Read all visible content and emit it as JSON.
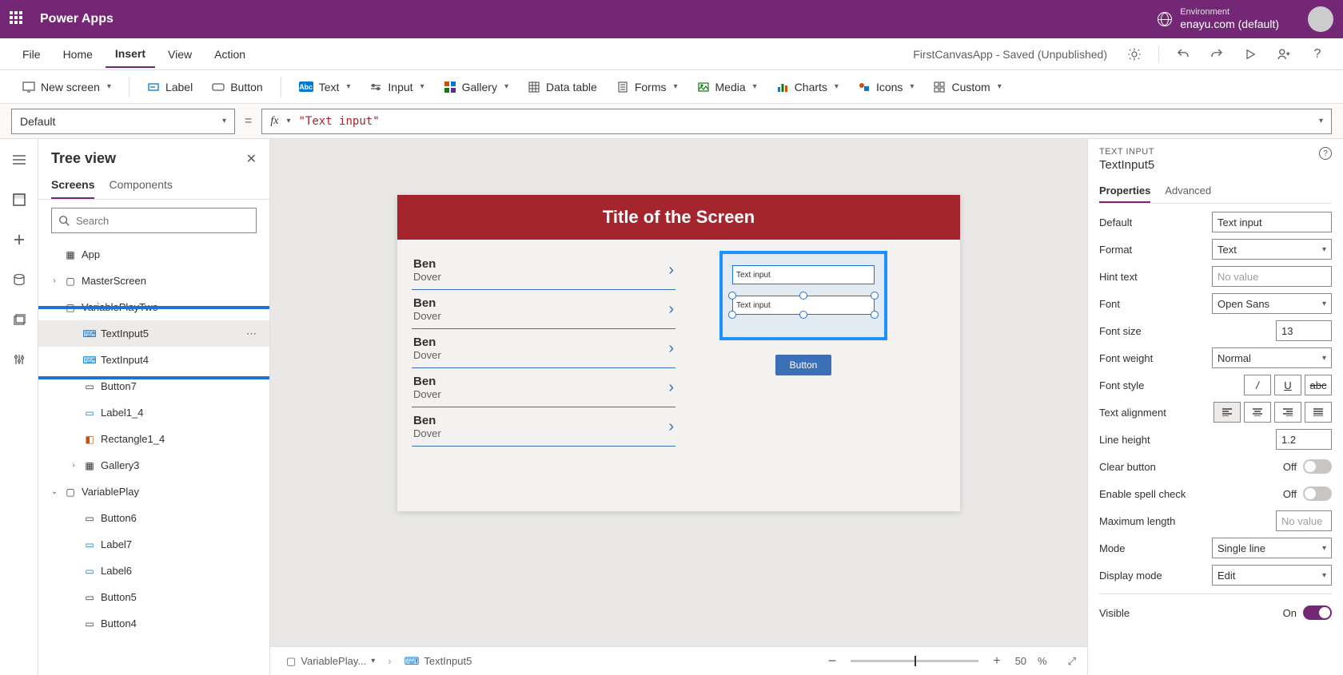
{
  "topbar": {
    "title": "Power Apps",
    "env_label": "Environment",
    "env_name": "enayu.com (default)"
  },
  "menu": {
    "items": [
      "File",
      "Home",
      "Insert",
      "View",
      "Action"
    ],
    "active": "Insert",
    "status": "FirstCanvasApp - Saved (Unpublished)"
  },
  "ribbon": {
    "newscreen": "New screen",
    "label": "Label",
    "button": "Button",
    "text": "Text",
    "input": "Input",
    "gallery": "Gallery",
    "datatable": "Data table",
    "forms": "Forms",
    "media": "Media",
    "charts": "Charts",
    "icons": "Icons",
    "custom": "Custom"
  },
  "formula": {
    "property": "Default",
    "value": "\"Text input\""
  },
  "tree": {
    "title": "Tree view",
    "tabs": {
      "screens": "Screens",
      "components": "Components"
    },
    "search_placeholder": "Search",
    "items": {
      "app": "App",
      "master": "MasterScreen",
      "vp2": "VariablePlayTwo",
      "ti5": "TextInput5",
      "ti4": "TextInput4",
      "btn7": "Button7",
      "lbl14": "Label1_4",
      "rect14": "Rectangle1_4",
      "gal3": "Gallery3",
      "vp": "VariablePlay",
      "btn6": "Button6",
      "lbl7": "Label7",
      "lbl6": "Label6",
      "btn5": "Button5",
      "btn4": "Button4"
    }
  },
  "canvas": {
    "screen_title": "Title of the Screen",
    "gallery_item": {
      "title": "Ben",
      "subtitle": "Dover"
    },
    "textinput_text": "Text input",
    "button_text": "Button"
  },
  "footer": {
    "crumb1": "VariablePlay...",
    "crumb2": "TextInput5",
    "zoom_minus": "−",
    "zoom_plus": "+",
    "zoom_value": "50",
    "zoom_pct": "%"
  },
  "props": {
    "type": "TEXT INPUT",
    "name": "TextInput5",
    "tabs": {
      "properties": "Properties",
      "advanced": "Advanced"
    },
    "rows": {
      "default_l": "Default",
      "default_v": "Text input",
      "format_l": "Format",
      "format_v": "Text",
      "hint_l": "Hint text",
      "hint_v": "No value",
      "font_l": "Font",
      "font_v": "Open Sans",
      "fontsize_l": "Font size",
      "fontsize_v": "13",
      "fontweight_l": "Font weight",
      "fontweight_v": "Normal",
      "fontstyle_l": "Font style",
      "align_l": "Text alignment",
      "lineheight_l": "Line height",
      "lineheight_v": "1.2",
      "clear_l": "Clear button",
      "clear_v": "Off",
      "spell_l": "Enable spell check",
      "spell_v": "Off",
      "maxlen_l": "Maximum length",
      "maxlen_v": "No value",
      "mode_l": "Mode",
      "mode_v": "Single line",
      "display_l": "Display mode",
      "display_v": "Edit",
      "visible_l": "Visible",
      "visible_v": "On"
    }
  }
}
